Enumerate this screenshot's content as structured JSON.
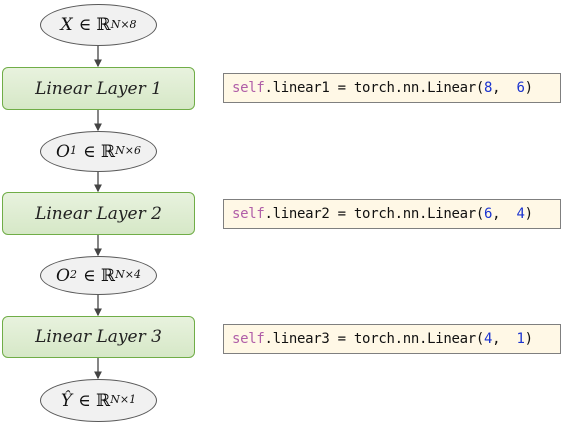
{
  "nodes": {
    "input": {
      "var": "X",
      "set": "∈ ℝ",
      "sup": "N×8"
    },
    "out1": {
      "var": "O",
      "var_sup": "1",
      "set": "∈ ℝ",
      "sup": "N×6"
    },
    "out2": {
      "var": "O",
      "var_sup": "2",
      "set": "∈ ℝ",
      "sup": "N×4"
    },
    "output": {
      "var": "Ŷ",
      "set": "∈ ℝ",
      "sup": "N×1"
    }
  },
  "layers": [
    {
      "label": "Linear Layer 1"
    },
    {
      "label": "Linear Layer 2"
    },
    {
      "label": "Linear Layer 3"
    }
  ],
  "code": [
    {
      "self": "self",
      "mid": ".linear1 = torch.nn.Linear(",
      "a": "8",
      "sep": ",  ",
      "b": "6",
      "end": ")"
    },
    {
      "self": "self",
      "mid": ".linear2 = torch.nn.Linear(",
      "a": "6",
      "sep": ",  ",
      "b": "4",
      "end": ")"
    },
    {
      "self": "self",
      "mid": ".linear3 = torch.nn.Linear(",
      "a": "4",
      "sep": ",  ",
      "b": "1",
      "end": ")"
    }
  ],
  "colors": {
    "layer_border": "#70ad47",
    "layer_fill": "#e2efd9",
    "ellipse_fill": "#f1f1f1",
    "code_fill": "#fff8e6",
    "keyword": "#b05ea8",
    "number": "#1a33d0"
  }
}
